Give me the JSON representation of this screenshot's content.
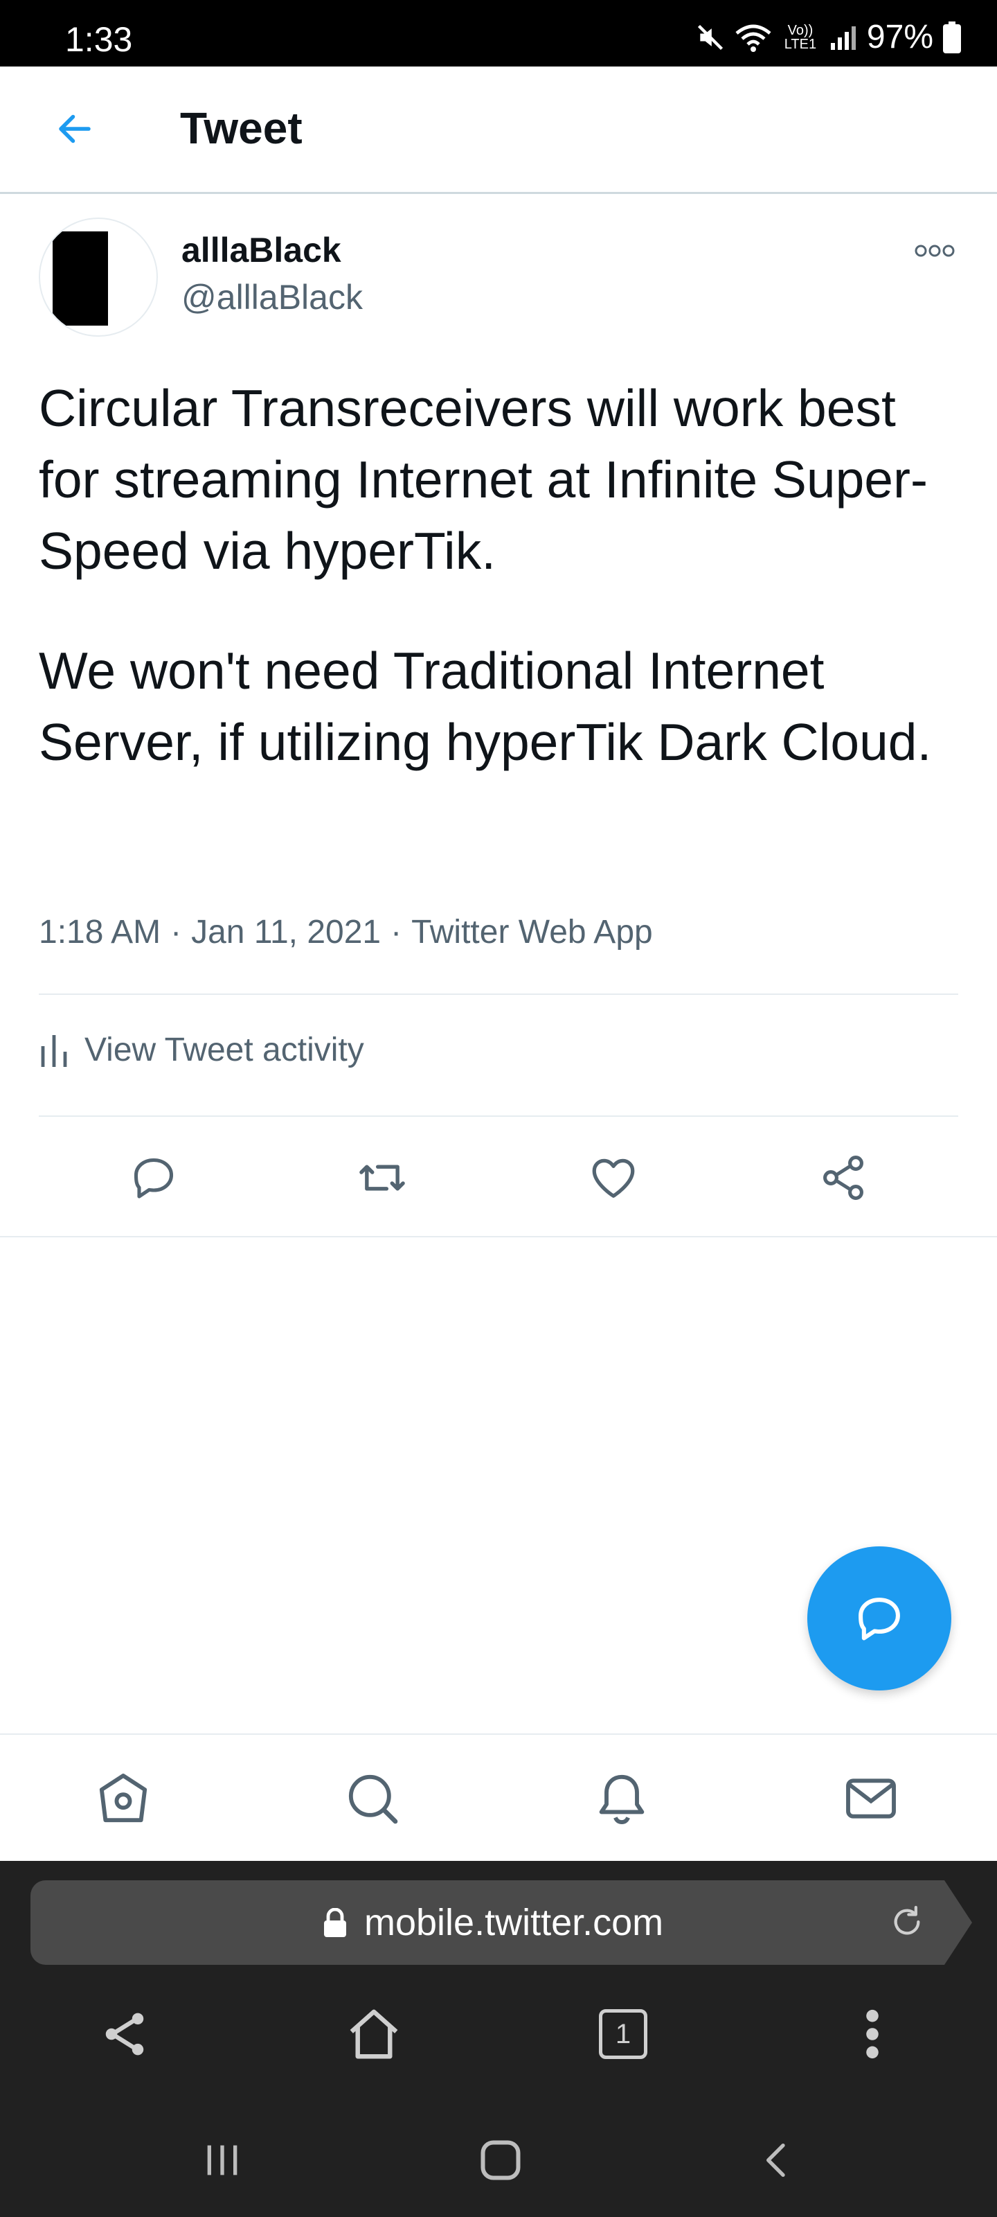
{
  "status_bar": {
    "time": "1:33",
    "battery": "97%",
    "network": "Vo)) LTE1"
  },
  "header": {
    "title": "Tweet",
    "back_icon": "arrow-left-icon"
  },
  "tweet": {
    "display_name": "alllaBlack",
    "handle": "@alllaBlack",
    "paragraphs": [
      "Circular Transreceivers will work best for streaming Internet at Infinite Super-Speed via hyperTik.",
      "We won't need Traditional Internet Server, if utilizing hyperTik Dark Cloud."
    ],
    "time": "1:18 AM",
    "date": "Jan 11, 2021",
    "source": "Twitter Web App",
    "separator": "·",
    "activity_label": "View Tweet activity"
  },
  "actions": [
    "reply-icon",
    "retweet-icon",
    "like-icon",
    "share-icon"
  ],
  "bottom_nav": [
    "home-icon",
    "search-icon",
    "notifications-icon",
    "messages-icon"
  ],
  "browser": {
    "url": "mobile.twitter.com",
    "tab_count": "1"
  },
  "colors": {
    "accent": "#1d9bf0",
    "secondary_text": "#536471",
    "primary_text": "#0f1419",
    "browser_bg": "#212121"
  }
}
